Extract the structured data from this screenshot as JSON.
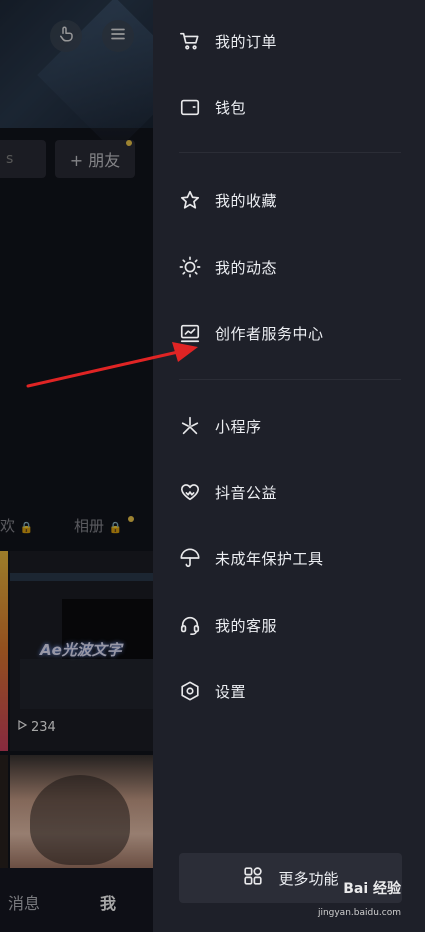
{
  "profile_bg": {
    "add_friend_label": "+ 朋友",
    "search_stub_text": "s",
    "tabs": {
      "tab_partial": "欢",
      "album": "相册"
    },
    "video_caption": "Ae光波文字",
    "play_count": "234",
    "bottom_nav": {
      "messages": "消息",
      "me": "我"
    }
  },
  "drawer": {
    "items": [
      {
        "label": "我的订单",
        "icon": "cart-icon"
      },
      {
        "label": "钱包",
        "icon": "wallet-icon"
      },
      {
        "label": "我的收藏",
        "icon": "star-icon"
      },
      {
        "label": "我的动态",
        "icon": "sun-icon"
      },
      {
        "label": "创作者服务中心",
        "icon": "creator-icon"
      },
      {
        "label": "小程序",
        "icon": "mini-program-icon"
      },
      {
        "label": "抖音公益",
        "icon": "heart-icon"
      },
      {
        "label": "未成年保护工具",
        "icon": "umbrella-icon"
      },
      {
        "label": "我的客服",
        "icon": "headset-icon"
      },
      {
        "label": "设置",
        "icon": "gear-icon"
      }
    ],
    "more_button": "更多功能"
  },
  "watermark": {
    "brand": "Bai 经验",
    "url": "jingyan.baidu.com"
  },
  "colors": {
    "arrow": "#e02424",
    "drawer_bg": "#1e2029",
    "accent_dot": "#f2c94c"
  }
}
